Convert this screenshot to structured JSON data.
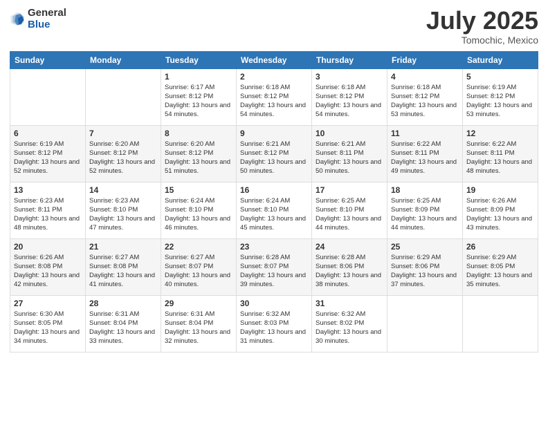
{
  "logo": {
    "general": "General",
    "blue": "Blue"
  },
  "title": "July 2025",
  "subtitle": "Tomochic, Mexico",
  "weekdays": [
    "Sunday",
    "Monday",
    "Tuesday",
    "Wednesday",
    "Thursday",
    "Friday",
    "Saturday"
  ],
  "weeks": [
    [
      {
        "day": "",
        "info": ""
      },
      {
        "day": "",
        "info": ""
      },
      {
        "day": "1",
        "info": "Sunrise: 6:17 AM\nSunset: 8:12 PM\nDaylight: 13 hours and 54 minutes."
      },
      {
        "day": "2",
        "info": "Sunrise: 6:18 AM\nSunset: 8:12 PM\nDaylight: 13 hours and 54 minutes."
      },
      {
        "day": "3",
        "info": "Sunrise: 6:18 AM\nSunset: 8:12 PM\nDaylight: 13 hours and 54 minutes."
      },
      {
        "day": "4",
        "info": "Sunrise: 6:18 AM\nSunset: 8:12 PM\nDaylight: 13 hours and 53 minutes."
      },
      {
        "day": "5",
        "info": "Sunrise: 6:19 AM\nSunset: 8:12 PM\nDaylight: 13 hours and 53 minutes."
      }
    ],
    [
      {
        "day": "6",
        "info": "Sunrise: 6:19 AM\nSunset: 8:12 PM\nDaylight: 13 hours and 52 minutes."
      },
      {
        "day": "7",
        "info": "Sunrise: 6:20 AM\nSunset: 8:12 PM\nDaylight: 13 hours and 52 minutes."
      },
      {
        "day": "8",
        "info": "Sunrise: 6:20 AM\nSunset: 8:12 PM\nDaylight: 13 hours and 51 minutes."
      },
      {
        "day": "9",
        "info": "Sunrise: 6:21 AM\nSunset: 8:12 PM\nDaylight: 13 hours and 50 minutes."
      },
      {
        "day": "10",
        "info": "Sunrise: 6:21 AM\nSunset: 8:11 PM\nDaylight: 13 hours and 50 minutes."
      },
      {
        "day": "11",
        "info": "Sunrise: 6:22 AM\nSunset: 8:11 PM\nDaylight: 13 hours and 49 minutes."
      },
      {
        "day": "12",
        "info": "Sunrise: 6:22 AM\nSunset: 8:11 PM\nDaylight: 13 hours and 48 minutes."
      }
    ],
    [
      {
        "day": "13",
        "info": "Sunrise: 6:23 AM\nSunset: 8:11 PM\nDaylight: 13 hours and 48 minutes."
      },
      {
        "day": "14",
        "info": "Sunrise: 6:23 AM\nSunset: 8:10 PM\nDaylight: 13 hours and 47 minutes."
      },
      {
        "day": "15",
        "info": "Sunrise: 6:24 AM\nSunset: 8:10 PM\nDaylight: 13 hours and 46 minutes."
      },
      {
        "day": "16",
        "info": "Sunrise: 6:24 AM\nSunset: 8:10 PM\nDaylight: 13 hours and 45 minutes."
      },
      {
        "day": "17",
        "info": "Sunrise: 6:25 AM\nSunset: 8:10 PM\nDaylight: 13 hours and 44 minutes."
      },
      {
        "day": "18",
        "info": "Sunrise: 6:25 AM\nSunset: 8:09 PM\nDaylight: 13 hours and 44 minutes."
      },
      {
        "day": "19",
        "info": "Sunrise: 6:26 AM\nSunset: 8:09 PM\nDaylight: 13 hours and 43 minutes."
      }
    ],
    [
      {
        "day": "20",
        "info": "Sunrise: 6:26 AM\nSunset: 8:08 PM\nDaylight: 13 hours and 42 minutes."
      },
      {
        "day": "21",
        "info": "Sunrise: 6:27 AM\nSunset: 8:08 PM\nDaylight: 13 hours and 41 minutes."
      },
      {
        "day": "22",
        "info": "Sunrise: 6:27 AM\nSunset: 8:07 PM\nDaylight: 13 hours and 40 minutes."
      },
      {
        "day": "23",
        "info": "Sunrise: 6:28 AM\nSunset: 8:07 PM\nDaylight: 13 hours and 39 minutes."
      },
      {
        "day": "24",
        "info": "Sunrise: 6:28 AM\nSunset: 8:06 PM\nDaylight: 13 hours and 38 minutes."
      },
      {
        "day": "25",
        "info": "Sunrise: 6:29 AM\nSunset: 8:06 PM\nDaylight: 13 hours and 37 minutes."
      },
      {
        "day": "26",
        "info": "Sunrise: 6:29 AM\nSunset: 8:05 PM\nDaylight: 13 hours and 35 minutes."
      }
    ],
    [
      {
        "day": "27",
        "info": "Sunrise: 6:30 AM\nSunset: 8:05 PM\nDaylight: 13 hours and 34 minutes."
      },
      {
        "day": "28",
        "info": "Sunrise: 6:31 AM\nSunset: 8:04 PM\nDaylight: 13 hours and 33 minutes."
      },
      {
        "day": "29",
        "info": "Sunrise: 6:31 AM\nSunset: 8:04 PM\nDaylight: 13 hours and 32 minutes."
      },
      {
        "day": "30",
        "info": "Sunrise: 6:32 AM\nSunset: 8:03 PM\nDaylight: 13 hours and 31 minutes."
      },
      {
        "day": "31",
        "info": "Sunrise: 6:32 AM\nSunset: 8:02 PM\nDaylight: 13 hours and 30 minutes."
      },
      {
        "day": "",
        "info": ""
      },
      {
        "day": "",
        "info": ""
      }
    ]
  ]
}
